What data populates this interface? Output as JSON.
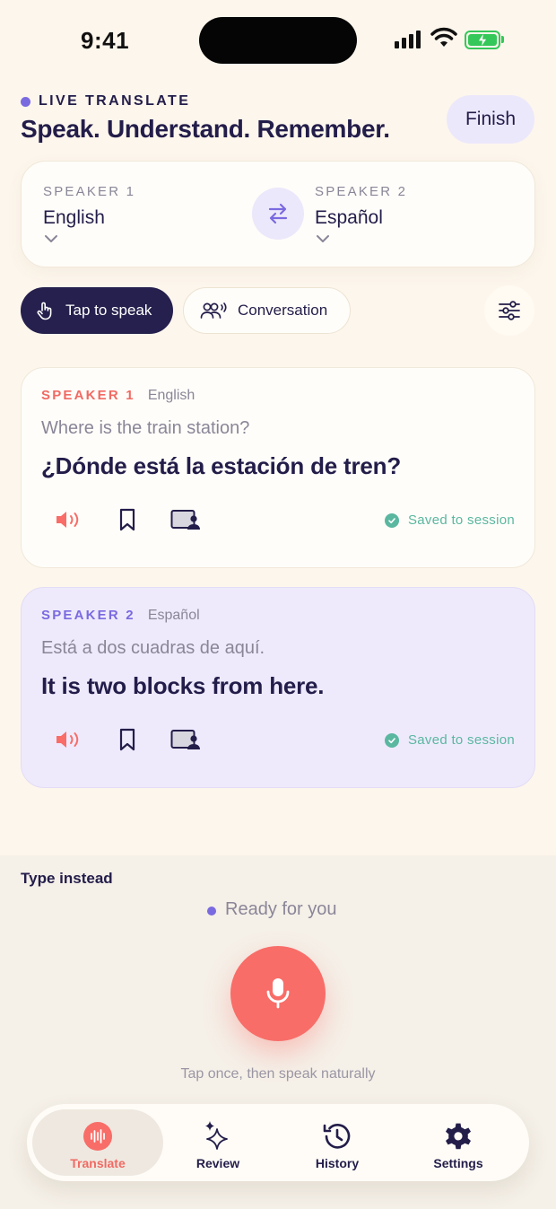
{
  "status_bar": {
    "time": "9:41"
  },
  "header": {
    "eyebrow": "LIVE TRANSLATE",
    "title": "Speak. Understand. Remember.",
    "finish_label": "Finish"
  },
  "languages": {
    "speaker1": {
      "label": "SPEAKER 1",
      "language": "English"
    },
    "speaker2": {
      "label": "SPEAKER 2",
      "language": "Español"
    },
    "swap_icon": "swap-arrows-icon"
  },
  "modes": {
    "tap_to_speak": "Tap to speak",
    "conversation": "Conversation",
    "settings_icon": "sliders-icon"
  },
  "messages": [
    {
      "speaker": "SPEAKER 1",
      "language": "English",
      "original": "Where is the train station?",
      "translation": "¿Dónde está la estación de tren?",
      "saved": "Saved to session",
      "tag_color": "#f06a63"
    },
    {
      "speaker": "SPEAKER 2",
      "language": "Español",
      "original": "Está a dos cuadras de aquí.",
      "translation": "It is two blocks from here.",
      "saved": "Saved to session",
      "tag_color": "#7a6ae0"
    }
  ],
  "input": {
    "type_instead": "Type instead",
    "status": "Ready for you",
    "hint": "Tap once, then speak naturally"
  },
  "tabs": [
    {
      "label": "Translate",
      "icon": "waveform-icon",
      "active": true
    },
    {
      "label": "Review",
      "icon": "sparkles-icon",
      "active": false
    },
    {
      "label": "History",
      "icon": "history-icon",
      "active": false
    },
    {
      "label": "Settings",
      "icon": "gear-icon",
      "active": false
    }
  ],
  "colors": {
    "background": "#fdf6ec",
    "ink": "#231d4a",
    "accent_purple": "#7a6ae0",
    "accent_coral": "#f86d68",
    "saved_green": "#5ab7a0"
  }
}
